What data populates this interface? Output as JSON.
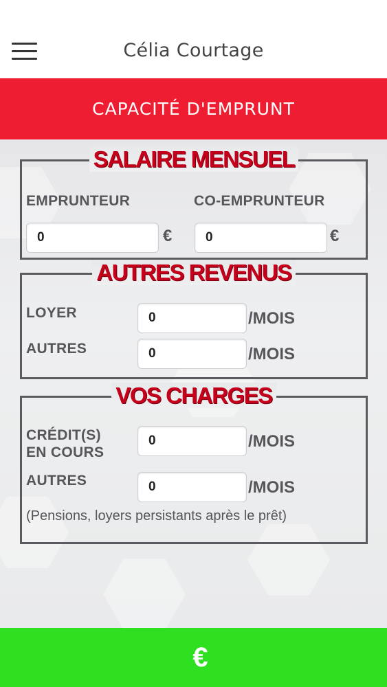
{
  "header": {
    "title": "Célia Courtage",
    "menu_icon": "hamburger-menu-icon"
  },
  "banner": {
    "label": "CAPACITÉ D'EMPRUNT",
    "color": "#ee1d31"
  },
  "sections": {
    "salaire": {
      "title": "SALAIRE MENSUEL",
      "emprunteur_label": "EMPRUNTEUR",
      "co_emprunteur_label": "CO-EMPRUNTEUR",
      "emprunteur_value": "0",
      "co_emprunteur_value": "0",
      "currency": "€"
    },
    "revenus": {
      "title": "AUTRES REVENUS",
      "loyer_label": "LOYER",
      "loyer_value": "0",
      "autres_label": "AUTRES",
      "autres_value": "0",
      "unit": "/MOIS"
    },
    "charges": {
      "title": "VOS CHARGES",
      "credits_label_line1": "CRÉDIT(S)",
      "credits_label_line2": "EN COURS",
      "credits_value": "0",
      "autres_label": "AUTRES",
      "autres_value": "0",
      "unit": "/MOIS",
      "note": "(Pensions, loyers persistants après le prêt)"
    }
  },
  "footer": {
    "icon": "€",
    "icon_name": "euro-icon",
    "color": "#2ee01f"
  },
  "colors": {
    "section_title": "#c4001a",
    "label": "#55555a",
    "frame": "#5a5a5f"
  }
}
